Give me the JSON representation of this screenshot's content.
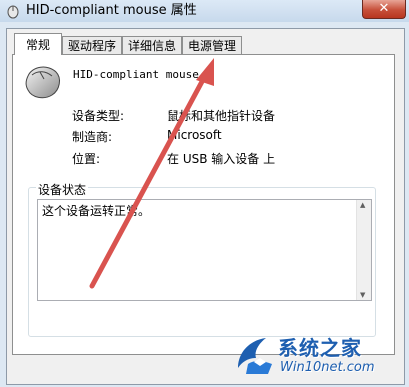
{
  "window": {
    "title": "HID-compliant mouse 属性",
    "close_glyph": "✕"
  },
  "tabs": [
    {
      "label": "常规",
      "active": true
    },
    {
      "label": "驱动程序",
      "active": false
    },
    {
      "label": "详细信息",
      "active": false
    },
    {
      "label": "电源管理",
      "active": false
    }
  ],
  "device": {
    "name": "HID-compliant mouse",
    "icon": "mouse-icon",
    "properties": [
      {
        "label": "设备类型:",
        "value": "鼠标和其他指针设备"
      },
      {
        "label": "制造商:",
        "value": "Microsoft"
      },
      {
        "label": "位置:",
        "value": "在 USB 输入设备 上"
      }
    ]
  },
  "status": {
    "legend": "设备状态",
    "text": "这个设备运转正常。"
  },
  "watermark": {
    "title": "系统之家",
    "url": "Win10net.com"
  },
  "colors": {
    "annotation_arrow": "#d9534f",
    "close_button": "#c7503a",
    "watermark": "#1e5fb0"
  }
}
